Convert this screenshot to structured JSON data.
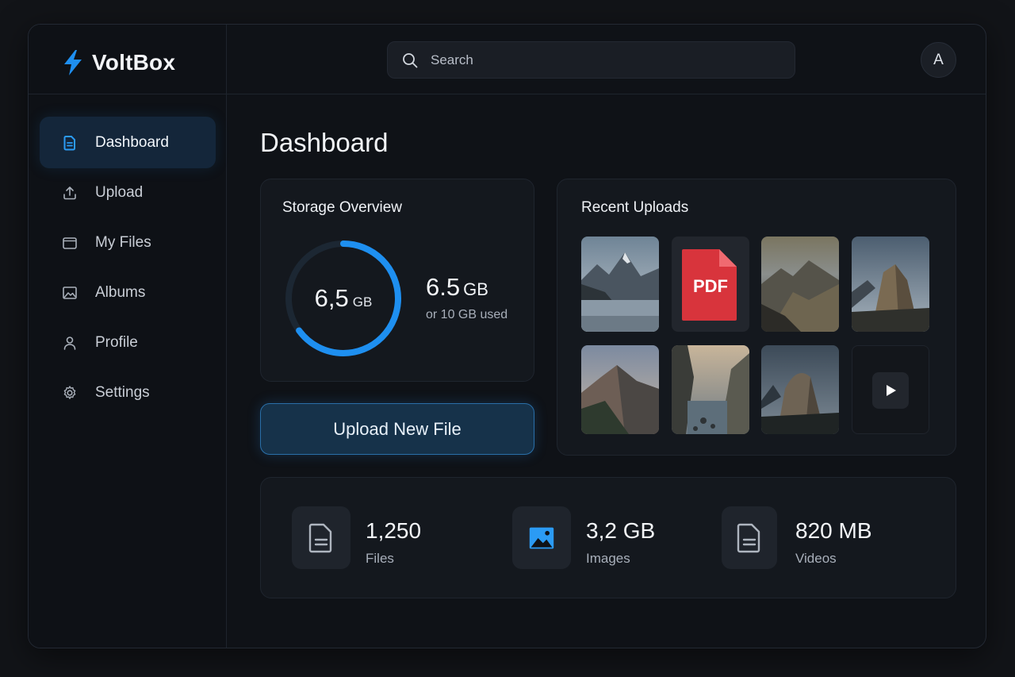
{
  "brand": {
    "name": "VoltBox",
    "accent": "#1e8ff0"
  },
  "search": {
    "placeholder": "Search"
  },
  "user": {
    "avatar_initial": "A"
  },
  "sidebar": {
    "items": [
      {
        "label": "Dashboard",
        "icon": "document-icon",
        "active": true
      },
      {
        "label": "Upload",
        "icon": "upload-icon",
        "active": false
      },
      {
        "label": "My Files",
        "icon": "folder-icon",
        "active": false
      },
      {
        "label": "Albums",
        "icon": "image-icon",
        "active": false
      },
      {
        "label": "Profile",
        "icon": "user-icon",
        "active": false
      },
      {
        "label": "Settings",
        "icon": "gear-icon",
        "active": false
      }
    ]
  },
  "main": {
    "title": "Dashboard",
    "storage": {
      "title": "Storage Overview",
      "ring_value": "6,5",
      "ring_unit": "GB",
      "used_value": "6.5",
      "used_unit": "GB",
      "used_sub": "or 10 GB used",
      "fraction_used": 0.65
    },
    "upload_button": "Upload New File",
    "recent_uploads": {
      "title": "Recent Uploads",
      "items": [
        {
          "type": "image",
          "icon": "mountain-lake-thumbnail"
        },
        {
          "type": "pdf",
          "label": "PDF",
          "icon": "pdf-icon"
        },
        {
          "type": "image",
          "icon": "mountain-valley-thumbnail"
        },
        {
          "type": "image",
          "icon": "rock-peak-thumbnail"
        },
        {
          "type": "image",
          "icon": "mountain-sunset-thumbnail"
        },
        {
          "type": "image",
          "icon": "coastal-cliffs-thumbnail"
        },
        {
          "type": "image",
          "icon": "rock-dome-thumbnail"
        },
        {
          "type": "video",
          "icon": "play-icon"
        }
      ]
    },
    "stats": [
      {
        "value": "1,250",
        "label": "Files",
        "icon": "file-icon"
      },
      {
        "value": "3,2 GB",
        "label": "Images",
        "icon": "image-icon"
      },
      {
        "value": "820 MB",
        "label": "Videos",
        "icon": "file-icon"
      }
    ]
  }
}
